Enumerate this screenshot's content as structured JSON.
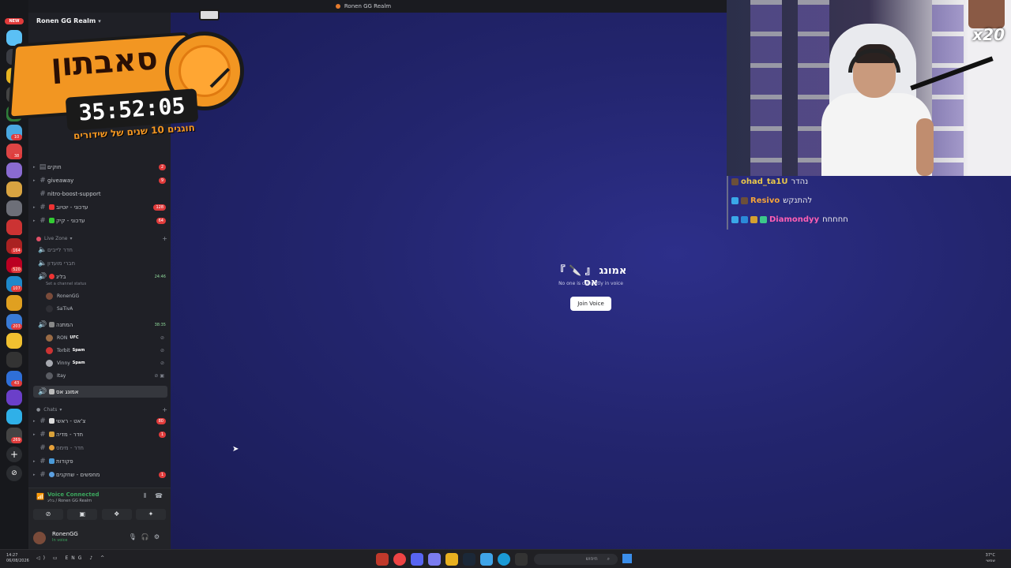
{
  "window": {
    "title": "Ronen GG Realm"
  },
  "rail": {
    "new_badge": "NEW",
    "badges": [
      "10",
      "38",
      "153",
      "164",
      "520",
      "107",
      "203",
      "43",
      "269"
    ]
  },
  "server": {
    "name": "Ronen GG Realm"
  },
  "channels": [
    {
      "label": "חוקים",
      "count": "2"
    },
    {
      "label": "giveaway",
      "count": "9"
    },
    {
      "label": "nitro-boost-support",
      "count": ""
    },
    {
      "label": "עדכוני - יוטיוב",
      "count": "128"
    },
    {
      "label": "עדכוני - קיק",
      "count": "64"
    }
  ],
  "live_zone": {
    "category": "Live Zone",
    "voice_channels": [
      {
        "label": "חדר לייבים",
        "timer": ""
      },
      {
        "label": "חברי מועדון",
        "timer": ""
      },
      {
        "label": "בליג",
        "timer": "24:46"
      }
    ],
    "set_status": "Set a channel status",
    "bliga_users": [
      "RonenGG",
      "SaTivA"
    ],
    "hamtana": {
      "label": "המתנה",
      "timer": "38:35"
    },
    "hamtana_users": [
      {
        "name": "RON",
        "tag": "UFC"
      },
      {
        "name": "Torbit",
        "tag": "Spam"
      },
      {
        "name": "Vinny",
        "tag": "Spam"
      },
      {
        "name": "Itay",
        "tag": ""
      }
    ],
    "active_channel": "אמונג אס"
  },
  "chats": {
    "category": "Chats",
    "items": [
      {
        "label": "צ'אט - ראשי",
        "count": "80"
      },
      {
        "label": "חדר - מדיה",
        "count": "1"
      },
      {
        "label": "חדר - מימס",
        "count": ""
      },
      {
        "label": "פקודות",
        "count": ""
      },
      {
        "label": "מחפשים - שחקנים",
        "count": "1"
      }
    ]
  },
  "voice_panel": {
    "title": "Voice Connected",
    "subtitle": "בליג / Ronen GG Realm"
  },
  "user_panel": {
    "name": "RonenGG",
    "status": "In voice"
  },
  "main": {
    "channel_title": "『 🔪 』 אמונג אס",
    "empty_text": "No one is currently in voice",
    "join_button": "Join Voice"
  },
  "stream_overlay": {
    "subathon_title": "סאבתון",
    "timer": "35:52:05",
    "caption": "חוגגים 10 שנים של שידורים",
    "multiplier": "x20"
  },
  "chat": [
    {
      "user": "ohad_ta1U",
      "message": "נהדר",
      "color": "#e9c74a"
    },
    {
      "user": "Resivo",
      "message": "להתנקש",
      "color": "#f3a33a"
    },
    {
      "user": "Diamondyy",
      "message": "חחחחח",
      "color": "#ff5fb3"
    }
  ],
  "taskbar": {
    "time": "14:27",
    "date": "06/08/2026",
    "lang": "ENG",
    "search": "חיפוש",
    "temp": "37°C",
    "weather": "שמשי"
  }
}
